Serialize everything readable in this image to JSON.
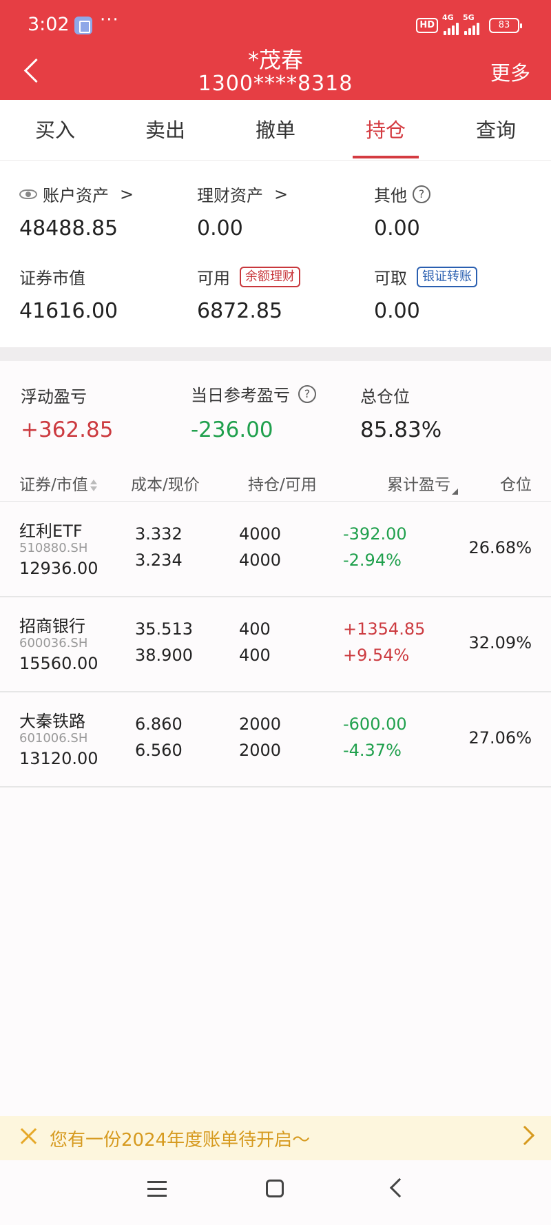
{
  "status_bar": {
    "time": "3:02",
    "dots": "···",
    "hd_badge": "HD",
    "network1": "4G",
    "network2": "5G",
    "battery": "83"
  },
  "header": {
    "title": "*茂春",
    "account": "1300****8318",
    "more": "更多"
  },
  "tabs": [
    {
      "label": "买入"
    },
    {
      "label": "卖出"
    },
    {
      "label": "撤单"
    },
    {
      "label": "持仓",
      "active": true
    },
    {
      "label": "查询"
    }
  ],
  "assets": {
    "account_assets": {
      "label": "账户资产",
      "suffix": ">",
      "value": "48488.85"
    },
    "wealth_assets": {
      "label": "理财资产",
      "suffix": ">",
      "value": "0.00"
    },
    "other": {
      "label": "其他",
      "help": "?",
      "value": "0.00"
    },
    "securities_value": {
      "label": "证券市值",
      "value": "41616.00"
    },
    "available": {
      "label": "可用",
      "tag": "余额理财",
      "value": "6872.85"
    },
    "withdrawable": {
      "label": "可取",
      "tag": "银证转账",
      "value": "0.00"
    }
  },
  "summary": {
    "floating_pnl": {
      "label": "浮动盈亏",
      "value": "+362.85"
    },
    "daily_pnl": {
      "label": "当日参考盈亏",
      "help": "?",
      "value": "-236.00"
    },
    "total_position": {
      "label": "总仓位",
      "value": "85.83%"
    }
  },
  "table": {
    "headers": [
      "证券/市值",
      "成本/现价",
      "持仓/可用",
      "累计盈亏",
      "仓位"
    ],
    "rows": [
      {
        "name": "红利ETF",
        "code": "510880.SH",
        "market_value": "12936.00",
        "cost": "3.332",
        "price": "3.234",
        "hold": "4000",
        "avail": "4000",
        "pnl": "-392.00",
        "pnl_pct": "-2.94%",
        "position": "26.68%",
        "pnl_color": "green"
      },
      {
        "name": "招商银行",
        "code": "600036.SH",
        "market_value": "15560.00",
        "cost": "35.513",
        "price": "38.900",
        "hold": "400",
        "avail": "400",
        "pnl": "+1354.85",
        "pnl_pct": "+9.54%",
        "position": "32.09%",
        "pnl_color": "red"
      },
      {
        "name": "大秦铁路",
        "code": "601006.SH",
        "market_value": "13120.00",
        "cost": "6.860",
        "price": "6.560",
        "hold": "2000",
        "avail": "2000",
        "pnl": "-600.00",
        "pnl_pct": "-4.37%",
        "position": "27.06%",
        "pnl_color": "green"
      }
    ]
  },
  "banner": {
    "text": "您有一份2024年度账单待开启～"
  },
  "colors": {
    "brand": "#e63e44",
    "gain": "#cc3b40",
    "loss": "#20a04d",
    "banner_text": "#d69a1f"
  }
}
